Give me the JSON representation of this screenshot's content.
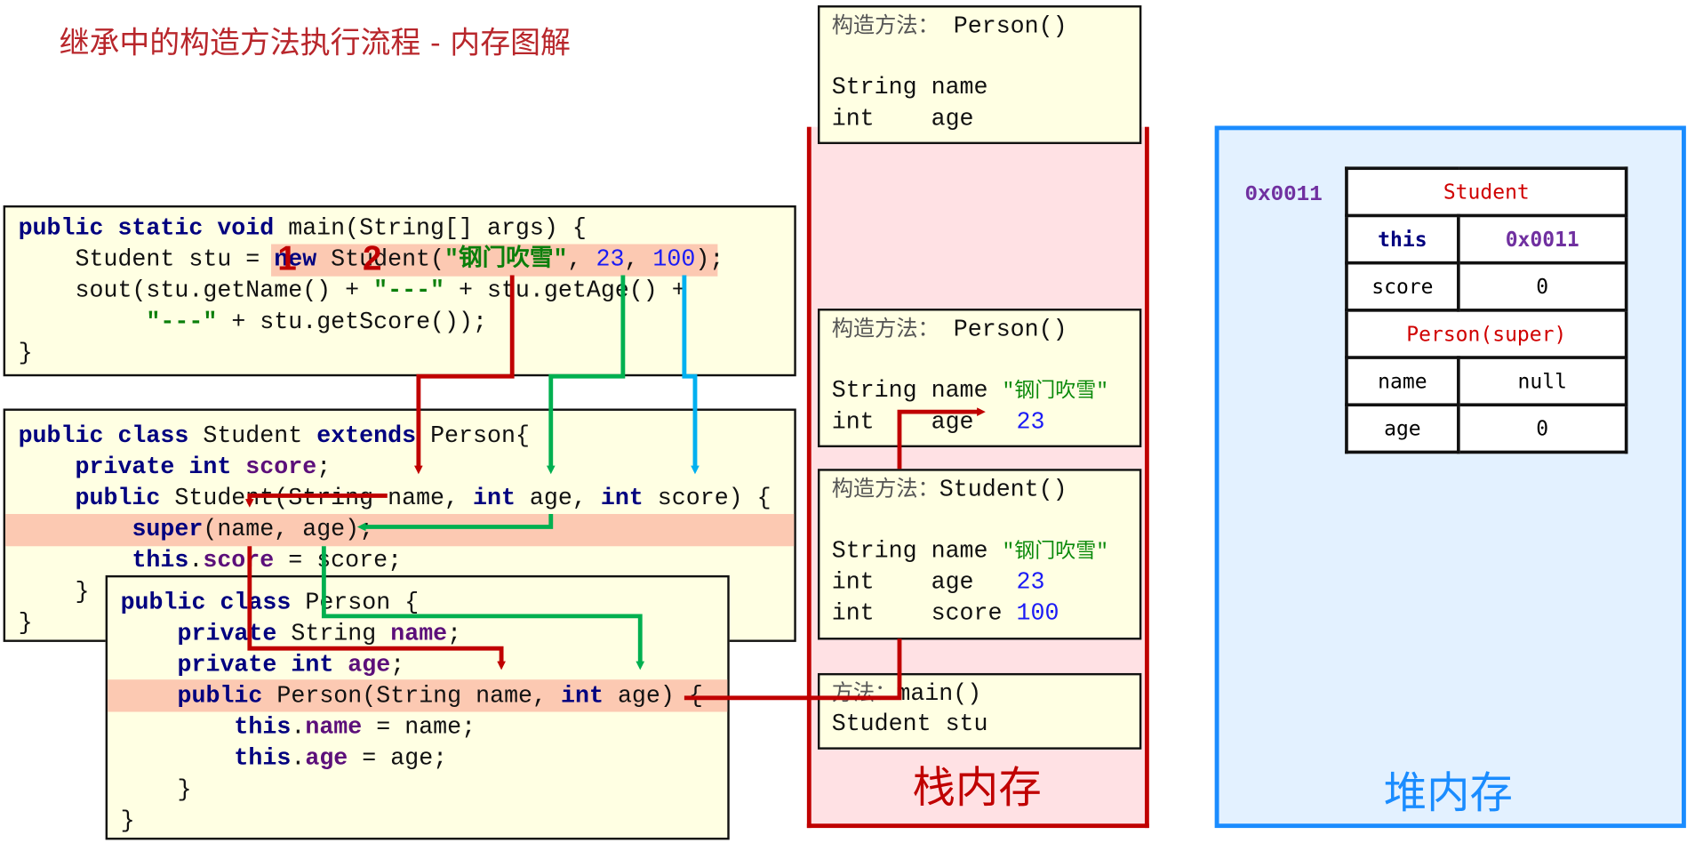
{
  "title": "继承中的构造方法执行流程 - 内存图解",
  "step_labels": [
    "1",
    "2"
  ],
  "code": {
    "main": [
      [
        [
          "public static void",
          "k"
        ],
        [
          " main(String[] args) {",
          "p"
        ]
      ],
      [
        [
          "    Student stu = ",
          "p"
        ],
        [
          "new",
          "k"
        ],
        [
          " Student(",
          "p"
        ],
        [
          "\"钢门吹雪\"",
          "s"
        ],
        [
          ", ",
          "p"
        ],
        [
          "23",
          "n"
        ],
        [
          ", ",
          "p"
        ],
        [
          "100",
          "n"
        ],
        [
          ");",
          "p"
        ]
      ],
      [
        [
          "    sout(stu.getName() + ",
          "p"
        ],
        [
          "\"---\"",
          "s"
        ],
        [
          " + stu.getAge() +",
          "p"
        ]
      ],
      [
        [
          "         ",
          "p"
        ],
        [
          "\"---\"",
          "s"
        ],
        [
          " + stu.getScore());",
          "p"
        ]
      ],
      [
        [
          "}",
          "p"
        ]
      ]
    ],
    "student": [
      [
        [
          "public class",
          "k"
        ],
        [
          " Student ",
          "p"
        ],
        [
          "extends",
          "k"
        ],
        [
          " Person{",
          "p"
        ]
      ],
      [
        [
          "    ",
          "p"
        ],
        [
          "private int",
          "k"
        ],
        [
          " ",
          "p"
        ],
        [
          "score",
          "f"
        ],
        [
          ";",
          "p"
        ]
      ],
      [
        [
          "    ",
          "p"
        ],
        [
          "public",
          "k"
        ],
        [
          " Student(String name, ",
          "p"
        ],
        [
          "int",
          "k"
        ],
        [
          " age, ",
          "p"
        ],
        [
          "int",
          "k"
        ],
        [
          " score) {",
          "p"
        ]
      ],
      [
        [
          "        ",
          "p"
        ],
        [
          "super",
          "k"
        ],
        [
          "(name, age);",
          "p"
        ]
      ],
      [
        [
          "        ",
          "p"
        ],
        [
          "this",
          "k"
        ],
        [
          ".",
          "p"
        ],
        [
          "score",
          "f"
        ],
        [
          " = score;",
          "p"
        ]
      ],
      [
        [
          "    }",
          "p"
        ]
      ],
      [
        [
          "}",
          "p"
        ]
      ]
    ],
    "person": [
      [
        [
          "public class",
          "k"
        ],
        [
          " Person {",
          "p"
        ]
      ],
      [
        [
          "    ",
          "p"
        ],
        [
          "private",
          "k"
        ],
        [
          " String ",
          "p"
        ],
        [
          "name",
          "f"
        ],
        [
          ";",
          "p"
        ]
      ],
      [
        [
          "    ",
          "p"
        ],
        [
          "private int",
          "k"
        ],
        [
          " ",
          "p"
        ],
        [
          "age",
          "f"
        ],
        [
          ";",
          "p"
        ]
      ],
      [
        [
          "    ",
          "p"
        ],
        [
          "public",
          "k"
        ],
        [
          " Person(String name, ",
          "p"
        ],
        [
          "int",
          "k"
        ],
        [
          " age) {",
          "p"
        ]
      ],
      [
        [
          "        ",
          "p"
        ],
        [
          "this",
          "k"
        ],
        [
          ".",
          "p"
        ],
        [
          "name",
          "f"
        ],
        [
          " = name;",
          "p"
        ]
      ],
      [
        [
          "        ",
          "p"
        ],
        [
          "this",
          "k"
        ],
        [
          ".",
          "p"
        ],
        [
          "age",
          "f"
        ],
        [
          " = age;",
          "p"
        ]
      ],
      [
        [
          "    }",
          "p"
        ]
      ],
      [
        [
          "}",
          "p"
        ]
      ]
    ]
  },
  "stack": {
    "label": "栈内存",
    "frames": [
      [
        [
          [
            "构造方法：",
            "cn"
          ],
          [
            " Person()",
            "p"
          ]
        ],
        [],
        [
          [
            "String name",
            "p"
          ]
        ],
        [
          [
            "int    age",
            "p"
          ]
        ]
      ],
      [
        [
          [
            "构造方法：",
            "cn"
          ],
          [
            " Person()",
            "p"
          ]
        ],
        [],
        [
          [
            "String name ",
            "p"
          ],
          [
            "\"钢门吹雪\"",
            "sv"
          ]
        ],
        [
          [
            "int    age   ",
            "p"
          ],
          [
            "23",
            "n"
          ]
        ]
      ],
      [
        [
          [
            "构造方法：",
            "cn"
          ],
          [
            "Student()",
            "p"
          ]
        ],
        [],
        [
          [
            "String name ",
            "p"
          ],
          [
            "\"钢门吹雪\"",
            "sv"
          ]
        ],
        [
          [
            "int    age   ",
            "p"
          ],
          [
            "23",
            "n"
          ]
        ],
        [
          [
            "int    score ",
            "p"
          ],
          [
            "100",
            "n"
          ]
        ]
      ],
      [
        [
          [
            "方法：",
            "cn"
          ],
          [
            "main()",
            "p"
          ]
        ],
        [
          [
            "Student stu",
            "p"
          ]
        ]
      ]
    ]
  },
  "heap": {
    "label": "堆内存",
    "address": "0x0011",
    "object": {
      "class_name": "Student",
      "rows": [
        {
          "key": "this",
          "value": "0x0011"
        },
        {
          "key": "score",
          "value": "0"
        }
      ],
      "super_name": "Person(super)",
      "super_rows": [
        {
          "key": "name",
          "value": "null"
        },
        {
          "key": "age",
          "value": "0"
        }
      ]
    }
  },
  "colors": {
    "red": "#c00000",
    "green": "#00b050",
    "blue": "#00b0f0",
    "heap_border": "#1a8cff",
    "stack_fill": "#ffe1e4",
    "heap_fill": "#e3f1ff",
    "highlight": "#fcc9b2"
  }
}
